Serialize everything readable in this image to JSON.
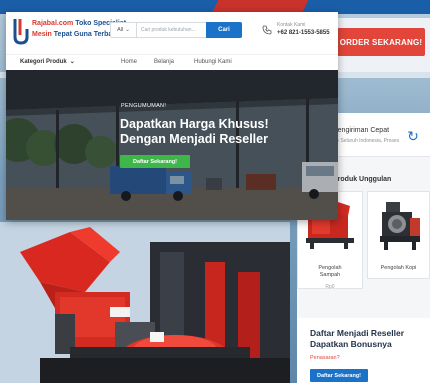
{
  "background": {
    "order_button": "ORDER SEKARANG!"
  },
  "site": {
    "logo": {
      "brand": "Rajabal",
      "domain": ".com",
      "tagline_1": " Toko Specialist",
      "tagline_2_red": "Mesin",
      "tagline_2": " Tepat Guna Terbaik"
    },
    "search": {
      "category": "All",
      "placeholder": "Cari produk kebutuhan...",
      "button": "Cari"
    },
    "contact": {
      "label": "Kontak Kami",
      "phone": "+62 821-1553-5855"
    },
    "nav": {
      "category_label": "Kategori Produk",
      "items": [
        "Home",
        "Belanja",
        "Hubungi Kami"
      ]
    },
    "hero": {
      "badge": "PENGUMUMAN!",
      "title_line1": "Dapatkan Harga Khusus!",
      "title_line2": "Dengan Menjadi Reseller",
      "button": "Daftar Sekarang!"
    }
  },
  "side": {
    "shipping_title": "Pengiriman Cepat",
    "shipping_sub": "Ke Seluruh Indonesia, Proses",
    "products_title": "Produk Unggulan",
    "products": [
      {
        "name_1": "Pengolah",
        "name_2": "Sampah",
        "price": "Rp0"
      },
      {
        "name_1": "Pengolah Kopi",
        "name_2": "",
        "price": ""
      }
    ],
    "reseller": {
      "title": "Daftar Menjadi Reseller Dapatkan Bonusnya",
      "question": "Penasaran?",
      "button": "Daftar Sekarang!"
    }
  },
  "colors": {
    "primary_blue": "#1b73c9",
    "accent_red": "#e2453a",
    "cta_green": "#3fb64a"
  }
}
